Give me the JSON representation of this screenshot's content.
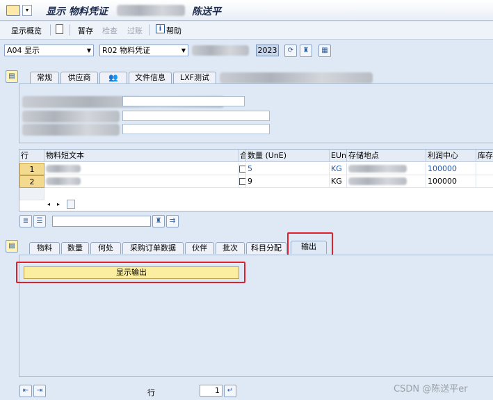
{
  "title": {
    "text": "显示 物料凭证",
    "user": "陈送平"
  },
  "toolbar": {
    "overview": "显示概览",
    "hold": "暂存",
    "check": "检查",
    "post": "过账",
    "help": "帮助"
  },
  "selection": {
    "action": "A04 显示",
    "reference": "R02 物料凭证",
    "year": "2023"
  },
  "header_tabs": [
    "常规",
    "供应商",
    "",
    "文件信息",
    "LXF测试"
  ],
  "table": {
    "columns": [
      "行",
      "物料短文本",
      "合",
      "数量 (UnE)",
      "EUn",
      "存储地点",
      "利润中心",
      "库存类"
    ],
    "rows": [
      {
        "line": "1",
        "qty": "5",
        "unit": "KG",
        "profit_center": "100000"
      },
      {
        "line": "2",
        "qty": "9",
        "unit": "KG",
        "profit_center": "100000"
      }
    ]
  },
  "item_tabs": [
    "物料",
    "数量",
    "何处",
    "采购订单数据",
    "伙伴",
    "批次",
    "科目分配",
    "输出"
  ],
  "output": {
    "button_label": "显示输出"
  },
  "footer": {
    "line_label": "行",
    "line_value": "1"
  },
  "watermark": "CSDN @陈送平er",
  "colors": {
    "highlight": "#e0202a",
    "accent_blue": "#1f56a8",
    "selected_row": "#f3da8f"
  }
}
